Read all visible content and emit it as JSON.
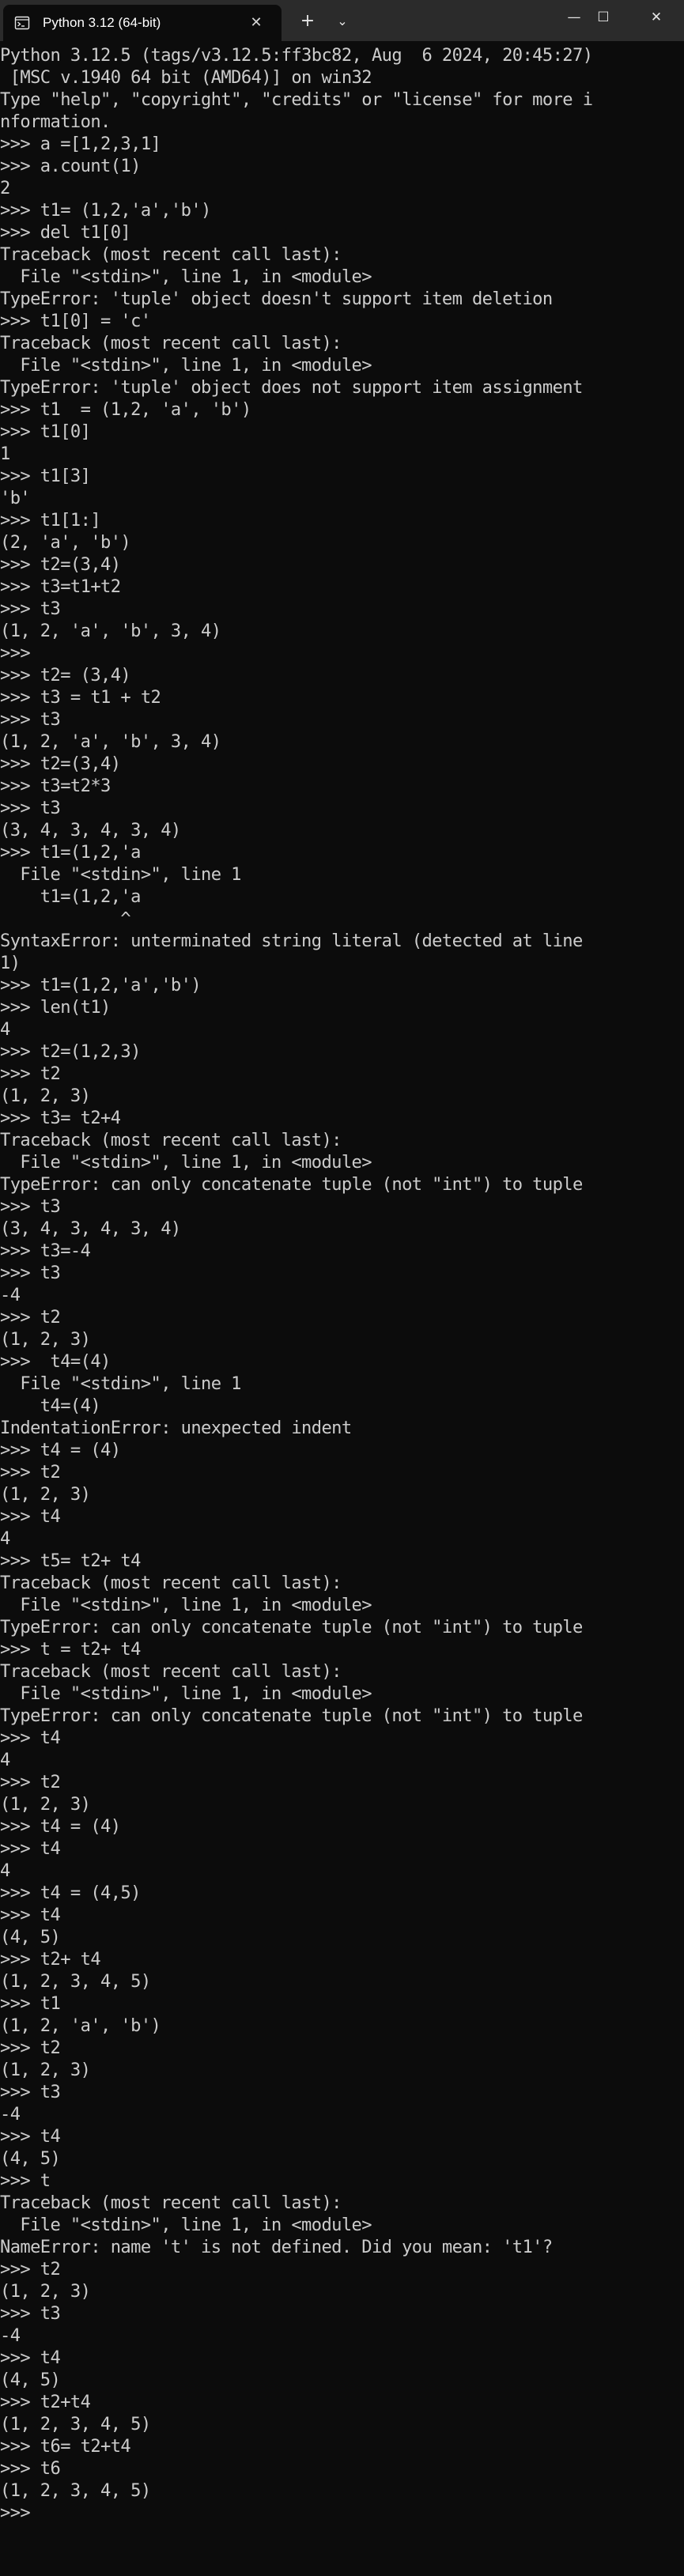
{
  "window": {
    "tab_title": "Python 3.12 (64-bit)",
    "tab_icon": "terminal-icon",
    "close_tab_glyph": "✕",
    "new_tab_glyph": "+",
    "dropdown_glyph": "⌄",
    "minimize_glyph": "—",
    "maximize_glyph": "☐",
    "close_glyph": "✕"
  },
  "colors": {
    "titlebar": "#2b2b2b",
    "background": "#0c0c0c",
    "text": "#cccccc"
  },
  "console": {
    "lines": [
      "Python 3.12.5 (tags/v3.12.5:ff3bc82, Aug  6 2024, 20:45:27)",
      " [MSC v.1940 64 bit (AMD64)] on win32",
      "Type \"help\", \"copyright\", \"credits\" or \"license\" for more i",
      "nformation.",
      ">>> a =[1,2,3,1]",
      ">>> a.count(1)",
      "2",
      ">>> t1= (1,2,'a','b')",
      ">>> del t1[0]",
      "Traceback (most recent call last):",
      "  File \"<stdin>\", line 1, in <module>",
      "TypeError: 'tuple' object doesn't support item deletion",
      ">>> t1[0] = 'c'",
      "Traceback (most recent call last):",
      "  File \"<stdin>\", line 1, in <module>",
      "TypeError: 'tuple' object does not support item assignment",
      ">>> t1  = (1,2, 'a', 'b')",
      ">>> t1[0]",
      "1",
      ">>> t1[3]",
      "'b'",
      ">>> t1[1:]",
      "(2, 'a', 'b')",
      ">>> t2=(3,4)",
      ">>> t3=t1+t2",
      ">>> t3",
      "(1, 2, 'a', 'b', 3, 4)",
      ">>>",
      ">>> t2= (3,4)",
      ">>> t3 = t1 + t2",
      ">>> t3",
      "(1, 2, 'a', 'b', 3, 4)",
      ">>> t2=(3,4)",
      ">>> t3=t2*3",
      ">>> t3",
      "(3, 4, 3, 4, 3, 4)",
      ">>> t1=(1,2,'a",
      "  File \"<stdin>\", line 1",
      "    t1=(1,2,'a",
      "            ^",
      "SyntaxError: unterminated string literal (detected at line",
      "1)",
      ">>> t1=(1,2,'a','b')",
      ">>> len(t1)",
      "4",
      ">>> t2=(1,2,3)",
      ">>> t2",
      "(1, 2, 3)",
      ">>> t3= t2+4",
      "Traceback (most recent call last):",
      "  File \"<stdin>\", line 1, in <module>",
      "TypeError: can only concatenate tuple (not \"int\") to tuple",
      ">>> t3",
      "(3, 4, 3, 4, 3, 4)",
      ">>> t3=-4",
      ">>> t3",
      "-4",
      ">>> t2",
      "(1, 2, 3)",
      ">>>  t4=(4)",
      "  File \"<stdin>\", line 1",
      "    t4=(4)",
      "IndentationError: unexpected indent",
      ">>> t4 = (4)",
      ">>> t2",
      "(1, 2, 3)",
      ">>> t4",
      "4",
      ">>> t5= t2+ t4",
      "Traceback (most recent call last):",
      "  File \"<stdin>\", line 1, in <module>",
      "TypeError: can only concatenate tuple (not \"int\") to tuple",
      ">>> t = t2+ t4",
      "Traceback (most recent call last):",
      "  File \"<stdin>\", line 1, in <module>",
      "TypeError: can only concatenate tuple (not \"int\") to tuple",
      ">>> t4",
      "4",
      ">>> t2",
      "(1, 2, 3)",
      ">>> t4 = (4)",
      ">>> t4",
      "4",
      ">>> t4 = (4,5)",
      ">>> t4",
      "(4, 5)",
      ">>> t2+ t4",
      "(1, 2, 3, 4, 5)",
      ">>> t1",
      "(1, 2, 'a', 'b')",
      ">>> t2",
      "(1, 2, 3)",
      ">>> t3",
      "-4",
      ">>> t4",
      "(4, 5)",
      ">>> t",
      "Traceback (most recent call last):",
      "  File \"<stdin>\", line 1, in <module>",
      "NameError: name 't' is not defined. Did you mean: 't1'?",
      ">>> t2",
      "(1, 2, 3)",
      ">>> t3",
      "-4",
      ">>> t4",
      "(4, 5)",
      ">>> t2+t4",
      "(1, 2, 3, 4, 5)",
      ">>> t6= t2+t4",
      ">>> t6",
      "(1, 2, 3, 4, 5)",
      ">>> "
    ]
  }
}
